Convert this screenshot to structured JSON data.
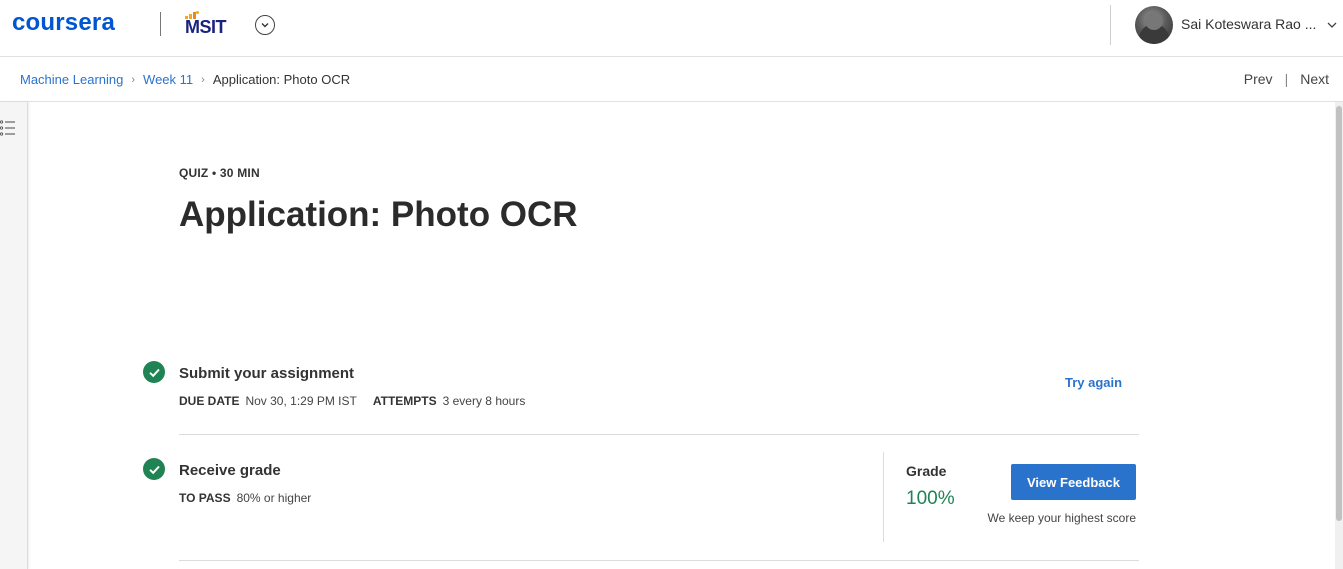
{
  "header": {
    "logo_text": "coursera",
    "partner_logo_text": "MSIT",
    "user_name": "Sai Koteswara Rao ...",
    "brand_color": "#0056d2"
  },
  "breadcrumb": {
    "items": [
      "Machine Learning",
      "Week 11"
    ],
    "current": "Application: Photo OCR",
    "prev_label": "Prev",
    "next_label": "Next"
  },
  "quiz": {
    "meta": "QUIZ • 30 MIN",
    "title": "Application: Photo OCR"
  },
  "submit_step": {
    "title": "Submit your assignment",
    "due_date_label": "DUE DATE",
    "due_date_value": "Nov 30, 1:29 PM IST",
    "attempts_label": "ATTEMPTS",
    "attempts_value": "3 every 8 hours",
    "try_again_label": "Try again",
    "completed": true
  },
  "grade_step": {
    "title": "Receive grade",
    "to_pass_label": "TO PASS",
    "to_pass_value": "80% or higher",
    "grade_label": "Grade",
    "grade_value": "100%",
    "view_feedback_label": "View Feedback",
    "highest_score_note": "We keep your highest score",
    "completed": true
  },
  "colors": {
    "success_green": "#1f8354",
    "link_blue": "#2a73cc",
    "button_blue": "#2a73cc"
  }
}
